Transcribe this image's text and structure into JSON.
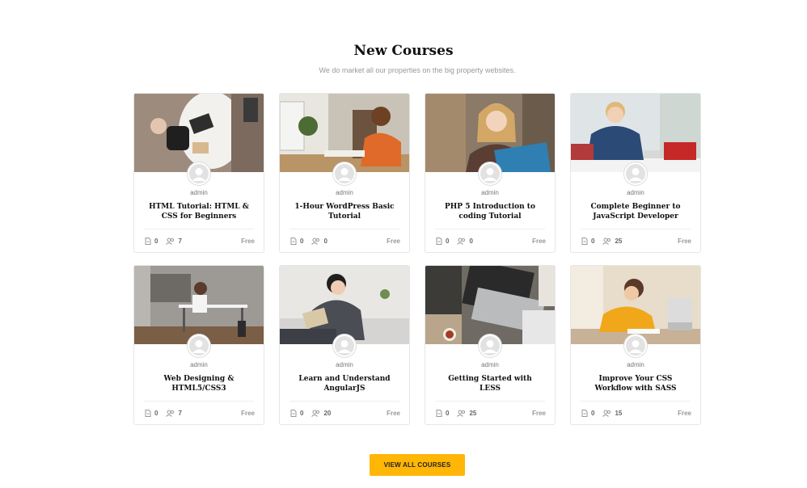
{
  "section": {
    "title": "New Courses",
    "subtitle": "We do market all our properties on the big property websites."
  },
  "courses": [
    {
      "author": "admin",
      "title": "HTML Tutorial: HTML & CSS for Beginners",
      "lessons": "0",
      "students": "7",
      "price": "Free"
    },
    {
      "author": "admin",
      "title": "1-Hour WordPress Basic Tutorial",
      "lessons": "0",
      "students": "0",
      "price": "Free"
    },
    {
      "author": "admin",
      "title": "PHP 5 Introduction to coding Tutorial",
      "lessons": "0",
      "students": "0",
      "price": "Free"
    },
    {
      "author": "admin",
      "title": "Complete Beginner to JavaScript Developer",
      "lessons": "0",
      "students": "25",
      "price": "Free"
    },
    {
      "author": "admin",
      "title": "Web Designing & HTML5/CSS3",
      "lessons": "0",
      "students": "7",
      "price": "Free"
    },
    {
      "author": "admin",
      "title": "Learn and Understand AngularJS",
      "lessons": "0",
      "students": "20",
      "price": "Free"
    },
    {
      "author": "admin",
      "title": "Getting Started with LESS",
      "lessons": "0",
      "students": "25",
      "price": "Free"
    },
    {
      "author": "admin",
      "title": "Improve Your CSS Workflow with SASS",
      "lessons": "0",
      "students": "15",
      "price": "Free"
    }
  ],
  "cta": {
    "label": "VIEW ALL COURSES"
  },
  "colors": {
    "accent": "#ffb606"
  }
}
